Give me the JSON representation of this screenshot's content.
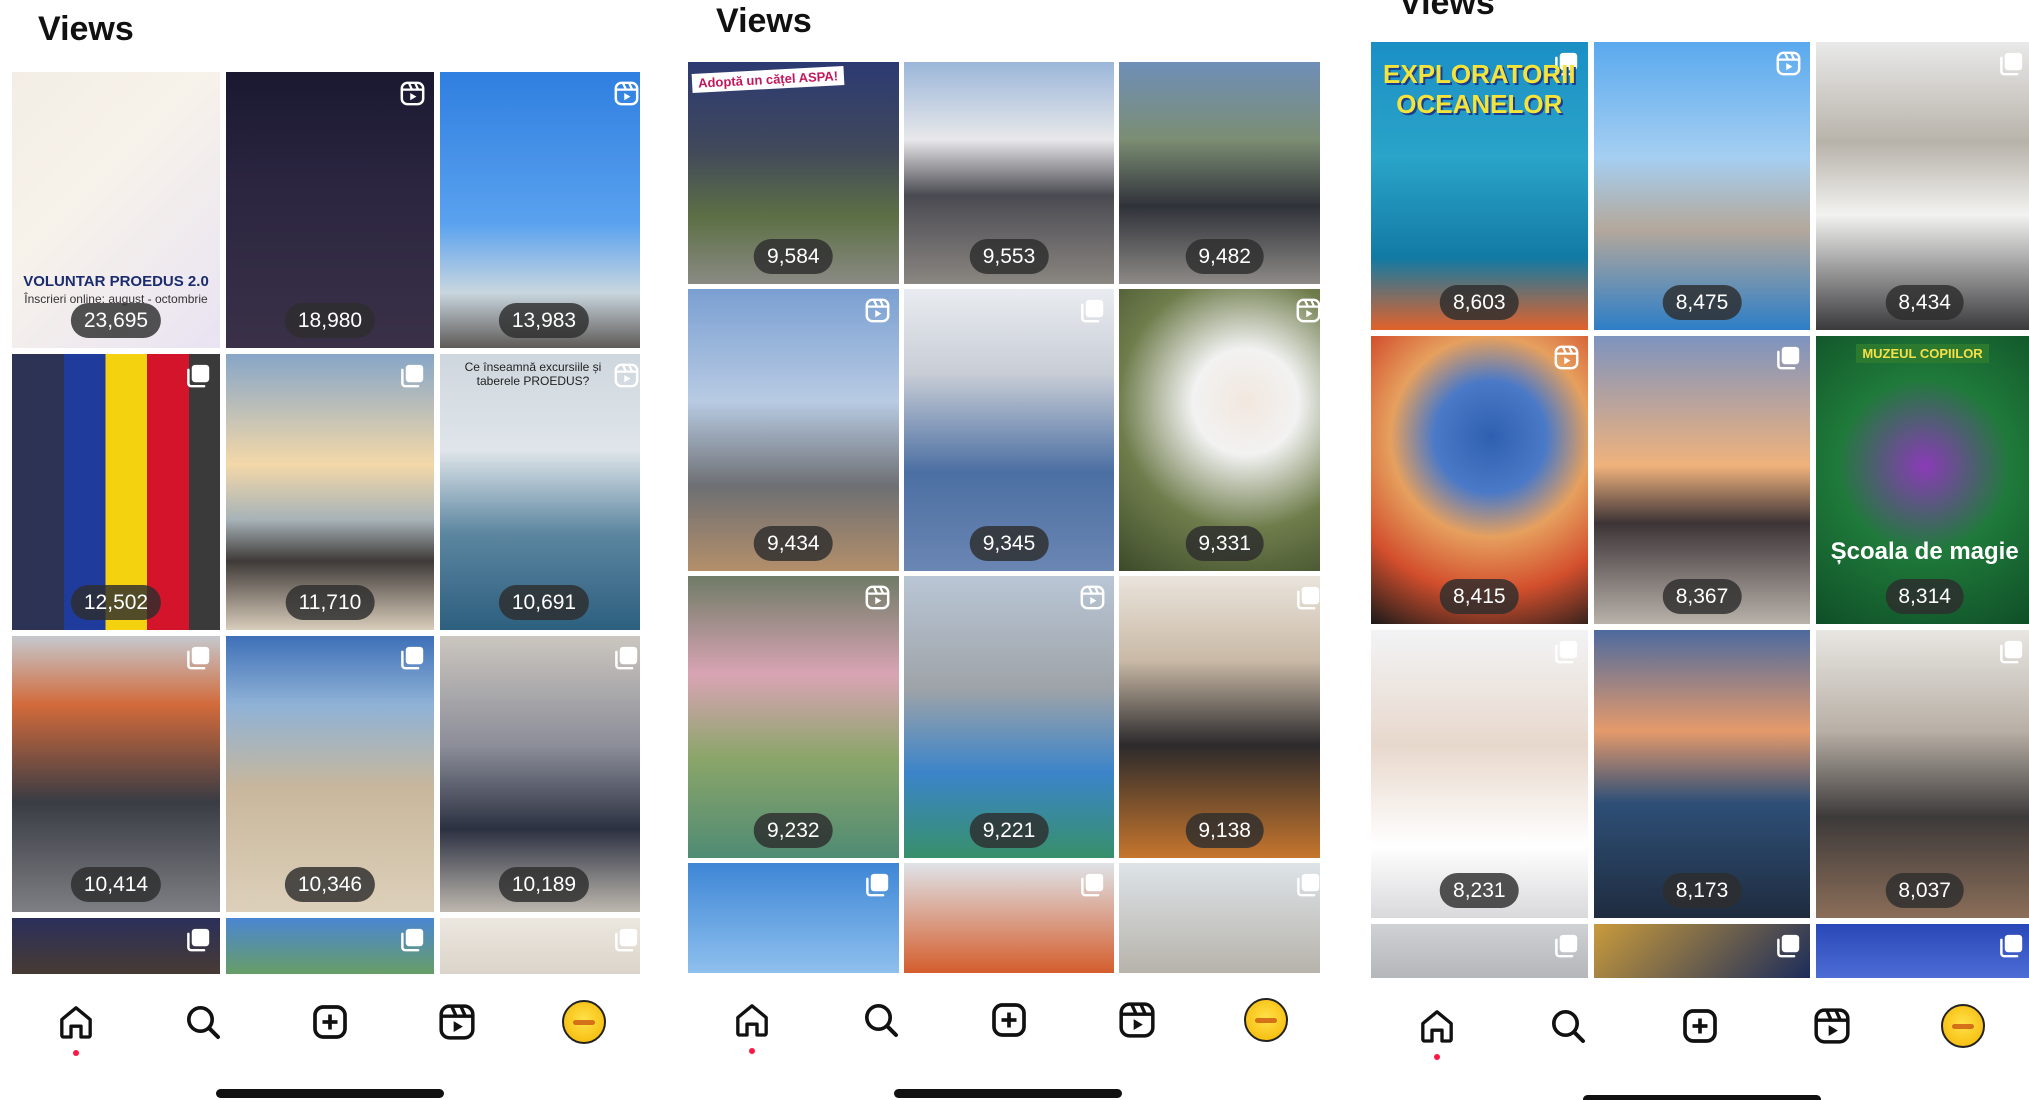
{
  "overlay_icons": {
    "reel": "reels-icon",
    "multi": "carousel-icon"
  },
  "nav_icons": [
    "home-icon",
    "search-icon",
    "create-icon",
    "reels-icon",
    "profile-avatar"
  ],
  "panels": [
    {
      "title": "Views",
      "tiles": [
        {
          "count": "23,695",
          "type": "poster",
          "caption": "VOLUNTAR PROEDUS 2.0",
          "sub": "Înscrieri online: august - octombrie",
          "bg": "linear-gradient(135deg,#f3eee5 0%,#f7f2ea 40%,#e9e3f3 100%)"
        },
        {
          "count": "18,980",
          "type": "reel",
          "bg": "linear-gradient(180deg,#1a1830 0%,#2b2540 40%,#3a3148 100%)"
        },
        {
          "count": "13,983",
          "type": "reel",
          "bg": "linear-gradient(180deg,#2f7fe0 0%,#5aa2ef 55%,#c9d6df 80%,#5e5a57 100%)"
        },
        {
          "count": "12,502",
          "type": "multi",
          "bg": "linear-gradient(90deg,#2c3354 0%,#2c3354 25%,#1f3b9b 25%,#1f3b9b 45%,#f5d20f 45%,#f5d20f 65%,#d4142a 65%,#d4142a 85%,#3a3a3a 85%)"
        },
        {
          "count": "11,710",
          "type": "multi",
          "bg": "linear-gradient(180deg,#87a6c8 0%,#f3d8a8 40%,#a7b3b8 60%,#3f3a38 75%,#d9cdbb 100%)"
        },
        {
          "count": "10,691",
          "type": "reel",
          "caption_top": "Ce înseamnă excursiile și taberele PROEDUS?",
          "bg": "linear-gradient(180deg,#cfd7de 0%,#dfe5ea 35%,#5c86a0 65%,#2d5f7f 100%)"
        },
        {
          "count": "10,414",
          "type": "multi",
          "bg": "linear-gradient(180deg,#c5c9ce 0%,#d26a3b 25%,#3a3c44 60%,#7d7f84 100%)"
        },
        {
          "count": "10,346",
          "type": "multi",
          "bg": "linear-gradient(180deg,#3e70b8 0%,#8fb2d6 25%,#c8b79c 55%,#ddd0ba 100%)"
        },
        {
          "count": "10,189",
          "type": "multi",
          "bg": "linear-gradient(180deg,#cbc6bf 0%,#8b8d98 40%,#2c3142 70%,#bdb7ae 100%)"
        },
        {
          "count": "",
          "type": "multi",
          "bg": "linear-gradient(180deg,#2b2f5b 0%,#4a3c2f 100%)"
        },
        {
          "count": "",
          "type": "multi",
          "bg": "linear-gradient(180deg,#4b86d3 0%,#6aa05b 100%)"
        },
        {
          "count": "",
          "type": "multi",
          "bg": "linear-gradient(180deg,#ece7df 0%,#d9d2c8 100%)"
        }
      ]
    },
    {
      "title": "Views",
      "tiles": [
        {
          "count": "9,584",
          "type": "none",
          "sign": "Adoptă un cățel ASPA!",
          "bg": "linear-gradient(180deg,#2c3a73 0%,#41495a 40%,#5d7045 70%,#8a8a84 100%)"
        },
        {
          "count": "9,553",
          "type": "none",
          "bg": "linear-gradient(180deg,#9ab6d9 0%,#e8e8ea 35%,#4a4a52 60%,#8a8680 100%)"
        },
        {
          "count": "9,482",
          "type": "none",
          "bg": "linear-gradient(180deg,#6f8fb8 0%,#7b8d73 35%,#30323a 65%,#8d8a86 100%)"
        },
        {
          "count": "9,434",
          "type": "reel",
          "bg": "linear-gradient(180deg,#7a9fd2 0%,#b8cbe3 40%,#6d6f73 70%,#b48f6a 100%)"
        },
        {
          "count": "9,345",
          "type": "multi",
          "bg": "linear-gradient(180deg,#e9ecf0 0%,#c8cdd6 30%,#4b6fa2 65%,#6b86b3 100%)"
        },
        {
          "count": "9,331",
          "type": "reel",
          "bg": "radial-gradient(circle at 60% 40%,#f2e7de 0%,#f2f2f2 25%,#6f7d4c 60%,#3d4a2a 100%)"
        },
        {
          "count": "9,232",
          "type": "reel",
          "bg": "linear-gradient(180deg,#6f7b66 0%,#d9a4b4 35%,#8aa569 65%,#4f8b74 100%)"
        },
        {
          "count": "9,221",
          "type": "reel",
          "bg": "linear-gradient(180deg,#b9c6d5 0%,#9ea3a8 40%,#3b84c9 70%,#37906a 100%)"
        },
        {
          "count": "9,138",
          "type": "multi",
          "bg": "linear-gradient(180deg,#eae4dc 0%,#c9b9a6 30%,#2c2a2c 60%,#c6762d 100%)"
        },
        {
          "count": "",
          "type": "multi",
          "bg": "linear-gradient(180deg,#3e86d6 0%,#8fc0ee 100%)"
        },
        {
          "count": "",
          "type": "multi",
          "bg": "linear-gradient(180deg,#dfe3e8 0%,#d45d2c 100%)"
        },
        {
          "count": "",
          "type": "multi",
          "bg": "linear-gradient(180deg,#dde3e8 0%,#b7b3ab 100%)"
        }
      ]
    },
    {
      "title": "Views",
      "tiles": [
        {
          "count": "8,603",
          "type": "multi",
          "caption": "EXPLORATORII OCEANELOR",
          "caption_color": "#f3e33a",
          "bg": "linear-gradient(180deg,#1b8fc5 0%,#2aa4c9 40%,#127aa4 75%,#e2622a 100%)"
        },
        {
          "count": "8,475",
          "type": "reel",
          "bg": "linear-gradient(180deg,#5aa9ee 0%,#a5cff2 40%,#b4a89b 65%,#2d7ec7 100%)"
        },
        {
          "count": "8,434",
          "type": "multi",
          "bg": "linear-gradient(180deg,#e9e9e9 0%,#b8b3aa 35%,#f2f2f0 60%,#3a3a3d 100%)"
        },
        {
          "count": "8,415",
          "type": "reel",
          "bg": "radial-gradient(circle at 55% 35%,#2f5fb0 0%,#4a79c7 25%,#e6a05e 45%,#d34f2d 70%,#1a1a1a 100%)"
        },
        {
          "count": "8,367",
          "type": "multi",
          "bg": "linear-gradient(180deg,#7e93bf 0%,#f0b27c 45%,#3d3437 65%,#b8b2aa 100%)"
        },
        {
          "count": "8,314",
          "type": "none",
          "caption": "Școala de magie",
          "caption_color": "#ffffff",
          "sign_top": "MUZEUL COPIILOR",
          "bg": "radial-gradient(circle at 50% 45%,#8a3bb7 0%,#1f7a3a 45%,#0f4e27 100%)"
        },
        {
          "count": "8,231",
          "type": "multi",
          "bg": "linear-gradient(180deg,#f2f3f5 0%,#e8d8cc 40%,#ffffff 75%,#d9d9dc 100%)"
        },
        {
          "count": "8,173",
          "type": "none",
          "bg": "linear-gradient(180deg,#4d6a9e 0%,#e59a6b 35%,#2e4f77 60%,#1f2c3f 100%)"
        },
        {
          "count": "8,037",
          "type": "multi",
          "bg": "linear-gradient(180deg,#e8e6e2 0%,#b8b0a6 35%,#3d3a3a 65%,#8b6e58 100%)"
        },
        {
          "count": "",
          "type": "multi",
          "bg": "linear-gradient(180deg,#cfd1d4 0%,#b4b7ba 100%)"
        },
        {
          "count": "",
          "type": "multi",
          "bg": "linear-gradient(135deg,#c99b3c 0%,#1c2c5a 100%)"
        },
        {
          "count": "",
          "type": "multi",
          "bg": "linear-gradient(180deg,#2948b7 0%,#4d6cd4 100%)"
        }
      ]
    }
  ]
}
